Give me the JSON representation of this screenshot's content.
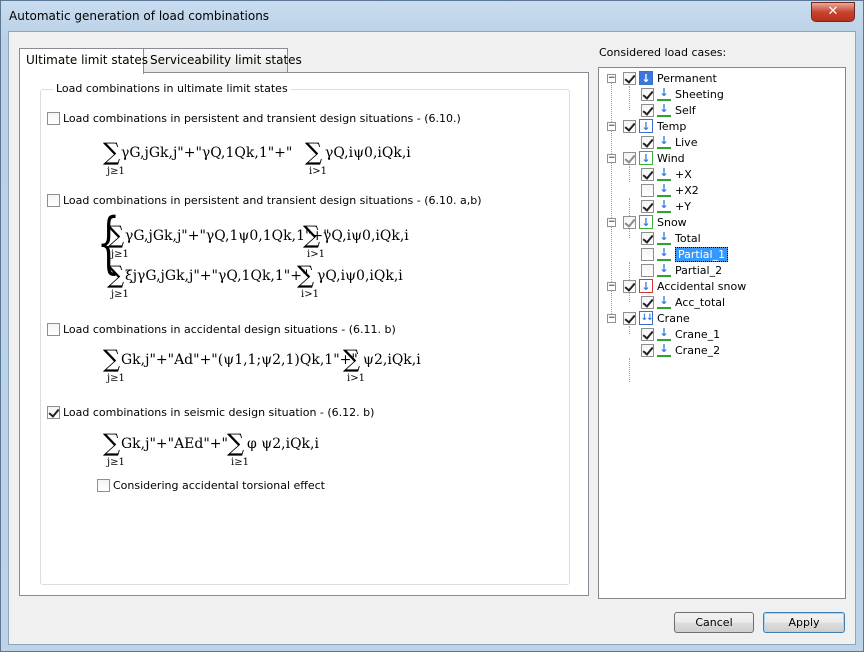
{
  "window": {
    "title": "Automatic generation of load combinations",
    "close_glyph": "✕"
  },
  "tabs": [
    {
      "label": "Ultimate limit states",
      "active": true
    },
    {
      "label": "Serviceability limit states",
      "active": false
    }
  ],
  "uls": {
    "group_title": "Load combinations in ultimate limit states",
    "options": [
      {
        "label": "Load combinations in persistent and transient design situations - (6.10.)",
        "checked": false
      },
      {
        "label": "Load combinations in persistent and transient design situations - (6.10. a,b)",
        "checked": false
      },
      {
        "label": "Load combinations in accidental design situations - (6.11. b)",
        "checked": false
      },
      {
        "label": "Load combinations in seismic design situation - (6.12. b)",
        "checked": true
      }
    ],
    "torsion_option": {
      "label": "Considering accidental torsional effect",
      "checked": false
    },
    "formulas": {
      "sigma": "∑",
      "sub_j": "j≥1",
      "sub_i": "i>1",
      "f1_a": "γG,jGk,j\"+\"γQ,1Qk,1\"+\"",
      "f1_b": "γQ,iψ0,iQk,i",
      "f2a_a": "γG,jGk,j\"+\"γQ,1ψ0,1Qk,1\"+\"",
      "f2a_b": "γQ,iψ0,iQk,i",
      "f2b_a": "ξjγG,jGk,j\"+\"γQ,1Qk,1\"+\"",
      "f2b_b": "γQ,iψ0,iQk,i",
      "f3_a": "Gk,j\"+\"Ad\"+\"(ψ1,1;ψ2,1)Qk,1\"+\"",
      "f3_b": "ψ2,iQk,i",
      "f4_a": "Gk,j\"+\"AEd\"+\"",
      "f4_b": "φ ψ2,iQk,i",
      "sub_i_ge": "i≥1",
      "brace": "{"
    }
  },
  "load_cases": {
    "label": "Considered load cases:",
    "groups": [
      {
        "name": "Permanent",
        "icon": "permanent-load-icon",
        "state": "checked",
        "children": [
          {
            "name": "Sheeting",
            "checked": true
          },
          {
            "name": "Self",
            "checked": true
          }
        ]
      },
      {
        "name": "Temp",
        "icon": "temporary-load-icon",
        "state": "checked",
        "children": [
          {
            "name": "Live",
            "checked": true
          }
        ]
      },
      {
        "name": "Wind",
        "icon": "wind-load-icon",
        "state": "partial",
        "children": [
          {
            "name": "+X",
            "checked": true
          },
          {
            "name": "+X2",
            "checked": false
          },
          {
            "name": "+Y",
            "checked": true
          }
        ]
      },
      {
        "name": "Snow",
        "icon": "snow-load-icon",
        "state": "partial",
        "children": [
          {
            "name": "Total",
            "checked": true
          },
          {
            "name": "Partial_1",
            "checked": false,
            "selected": true
          },
          {
            "name": "Partial_2",
            "checked": false
          }
        ]
      },
      {
        "name": "Accidental snow",
        "icon": "accidental-snow-load-icon",
        "state": "checked",
        "children": [
          {
            "name": "Acc_total",
            "checked": true
          }
        ]
      },
      {
        "name": "Crane",
        "icon": "crane-load-icon",
        "state": "checked",
        "children": [
          {
            "name": "Crane_1",
            "checked": true
          },
          {
            "name": "Crane_2",
            "checked": true
          }
        ]
      }
    ],
    "expand_glyph": "−",
    "load_arrow": "↓",
    "crane_arrows": "↓↓"
  },
  "buttons": {
    "cancel": "Cancel",
    "apply": "Apply"
  }
}
